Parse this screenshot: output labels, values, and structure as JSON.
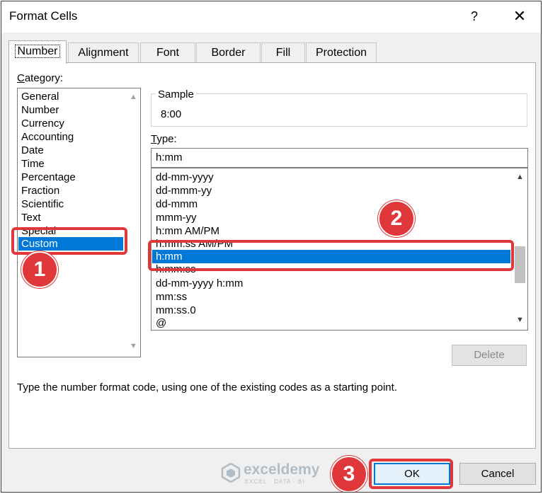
{
  "dialog": {
    "title": "Format Cells",
    "help_label": "?",
    "close_label": "✕"
  },
  "tabs": [
    {
      "label": "Number",
      "active": true
    },
    {
      "label": "Alignment"
    },
    {
      "label": "Font"
    },
    {
      "label": "Border"
    },
    {
      "label": "Fill"
    },
    {
      "label": "Protection"
    }
  ],
  "category": {
    "label_ul": "C",
    "label_rest": "ategory:",
    "items": [
      "General",
      "Number",
      "Currency",
      "Accounting",
      "Date",
      "Time",
      "Percentage",
      "Fraction",
      "Scientific",
      "Text",
      "Special",
      "Custom"
    ],
    "selected": "Custom"
  },
  "sample": {
    "label": "Sample",
    "value": "8:00"
  },
  "type": {
    "label_ul": "T",
    "label_rest": "ype:",
    "input_value": "h:mm",
    "items": [
      "dd-mm-yyyy",
      "dd-mmm-yy",
      "dd-mmm",
      "mmm-yy",
      "h:mm AM/PM",
      "h:mm:ss AM/PM",
      "h:mm",
      "h:mm:ss",
      "dd-mm-yyyy h:mm",
      "mm:ss",
      "mm:ss.0",
      "@"
    ],
    "selected": "h:mm"
  },
  "buttons": {
    "delete": "Delete",
    "ok": "OK",
    "cancel": "Cancel"
  },
  "hint": "Type the number format code, using one of the existing codes as a starting point.",
  "callouts": [
    "1",
    "2",
    "3"
  ],
  "watermark": {
    "name": "exceldemy",
    "tagline": "EXCEL · DATA · BI"
  },
  "colors": {
    "selection": "#0078d7",
    "callout": "#e0383a"
  }
}
